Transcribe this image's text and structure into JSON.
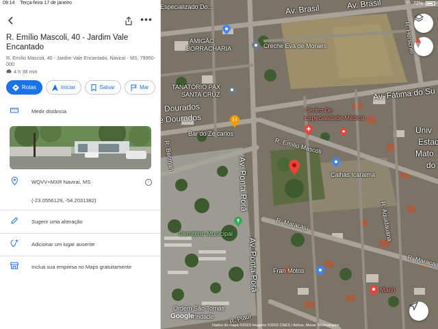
{
  "status": {
    "time": "09:14",
    "date": "Terça-feira 17 de janeiro",
    "battery": "72%"
  },
  "place": {
    "title": "R. Emílio Mascoli, 40 - Jardim Vale Encantado",
    "address": "R. Emílio Mascoli, 40 - Jardim Vale Encantado, Naviraí - MS, 79950-000",
    "eta": "4 h 38 min"
  },
  "actions": [
    {
      "label": "Rotas",
      "icon": "diamond-route-icon"
    },
    {
      "label": "Iniciar",
      "icon": "navigation-arrow-icon"
    },
    {
      "label": "Salvar",
      "icon": "bookmark-icon"
    },
    {
      "label": "Mar",
      "icon": "flag-icon"
    }
  ],
  "rows": {
    "measure": "Medir distância",
    "plus_code": "WQVV+MXR Naviraí, MS",
    "coords": "(-23.0556129, -54.2031382)",
    "suggest": "Sugerir uma alteração",
    "add_place": "Adicionar um lugar ausente",
    "business": "Inclua sua empresa no Maps gratuitamente"
  },
  "map": {
    "labels": {
      "especializado": "Especializado Do...",
      "av_brasil_1": "Av. Brasil",
      "av_brasil_2": "Av. Brasil",
      "r_herschel": "R. Herschel",
      "amigao": "AMIGÃO",
      "borracharia": "BORRACHARIA",
      "creche": "Creche Eva de Moraes",
      "tanatorio": "TANATÓRIO PAX",
      "santa_cruz": "SANTA CRUZ",
      "av_fatima": "Av. Fátima do Su",
      "centro_1": "Centro De",
      "centro_2": "Especialidade Médica",
      "dourados_1": "Dourados",
      "dourados_2": "e Dourados",
      "bar": "Bar do Zé carlos",
      "r_emilio": "R. Emílio Mascoli",
      "univ_1": "Univ",
      "univ_2": "Estad",
      "univ_3": "Mato",
      "univ_4": "do",
      "becman": "R. Becman",
      "ponta_pora_1": "Av. Ponta Porã",
      "ponta_pora_2": "Av. Ponta Porã",
      "calhas": "Calhas Icaraima",
      "maracaju_1": "R. Maracaju",
      "maracaju_2": "R. Maracaju",
      "aquidauana": "R. Aquidauana",
      "cemiterio": "Cemitério Municipal",
      "fran": "Fran Motos",
      "mario": "Mario",
      "sao_tomas_1": "Ordem São Tomás",
      "sao_tomas_2": "Trindade",
      "piaui": "R. Piauí",
      "google": "Google",
      "attribution": "Dados do mapa ©2023 Imagens ©2023 CNES / Airbus, Maxar Technologies"
    }
  }
}
